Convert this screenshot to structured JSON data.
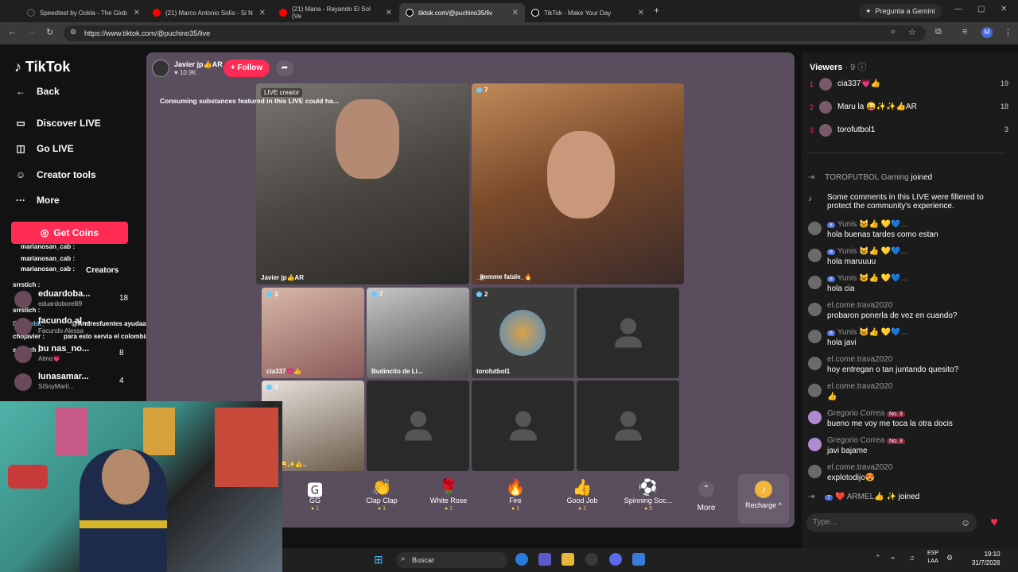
{
  "browser": {
    "tabs": [
      {
        "label": "Speedtest by Ookla - The Glob",
        "color": "#222",
        "active": false
      },
      {
        "label": "(21) Marco Antonio Solís - Si N",
        "color": "#ff0000",
        "active": false
      },
      {
        "label": "(21) Mana - Rayando El Sol (Ve",
        "color": "#ff0000",
        "active": false
      },
      {
        "label": "tiktok.com/@puchino35/liv",
        "color": "#111",
        "active": true
      },
      {
        "label": "TikTok - Make Your Day",
        "color": "#111",
        "active": false
      }
    ],
    "gemini_label": "Pregunta a Gemini",
    "url": "https://www.tiktok.com/@puchino35/live",
    "profile_initial": "M"
  },
  "sidebar": {
    "logo": "TikTok",
    "back": "Back",
    "items": [
      {
        "label": "Discover LIVE",
        "icon": "live-icon"
      },
      {
        "label": "Go LIVE",
        "icon": "camera-icon"
      },
      {
        "label": "Creator tools",
        "icon": "person-icon"
      },
      {
        "label": "More",
        "icon": "more-icon"
      }
    ],
    "get_coins": "Get Coins"
  },
  "left_overlay_chat": [
    "marianosan_cab :",
    "marianosan_cab :",
    "marianosan_cab :",
    "srrstich :",
    "srrstich :",
    "Deluxebk_",
    "@Andresfuentes ayudaaaaa",
    "chojavier :",
    "para esto servia el colombiano y el bolita agruck",
    "srrstich :",
    "Creators"
  ],
  "left_ranking": [
    {
      "name": "eduardoba...",
      "sub": "eduardoborelli9",
      "count": "18"
    },
    {
      "name": "facundo al...",
      "sub": "Facundo Alessa",
      "count": ""
    },
    {
      "name": "bu nas_no...",
      "sub": "Alma💗",
      "count": "8"
    },
    {
      "name": "lunasamar...",
      "sub": "SiSoyMaril...",
      "count": "4"
    }
  ],
  "live": {
    "host_name": "Javier jp👍AR",
    "host_likes": "10.9K",
    "follow_label": "+ Follow",
    "warning": "Consuming substances featured in this LIVE could ha...",
    "creator_badge": "LIVE creator",
    "main_left_label": "Javier jp👍AR",
    "main_right_label": "_𝕱emme fatale_🔥",
    "main_right_count": "7",
    "guests": [
      {
        "label": "cia337💗👍",
        "count": "3"
      },
      {
        "label": "Budincito de Li...",
        "count": "7"
      },
      {
        "label": "torofutbol1",
        "count": "2"
      },
      {
        "label": "",
        "count": ""
      },
      {
        "label": "u la 😜✨👍..",
        "count": "3"
      },
      {
        "label": "",
        "count": ""
      },
      {
        "label": "",
        "count": ""
      },
      {
        "label": "",
        "count": ""
      }
    ]
  },
  "gifts": [
    {
      "name": "GG",
      "icon": "gg-icon",
      "price": "1"
    },
    {
      "name": "Clap Clap",
      "icon": "clap-icon",
      "price": "1"
    },
    {
      "name": "White Rose",
      "icon": "rose-icon",
      "price": "1"
    },
    {
      "name": "Fire",
      "icon": "fire-icon",
      "price": "1"
    },
    {
      "name": "Good Job",
      "icon": "thumbs-up-icon",
      "price": "1"
    },
    {
      "name": "Spinning Soc...",
      "icon": "soccer-ball-icon",
      "price": "5"
    }
  ],
  "gift_more": "More",
  "recharge": "Recharge ^",
  "viewers": {
    "title": "Viewers",
    "count": "· 9",
    "list": [
      {
        "rank": "1",
        "name": "cia337💗👍",
        "count": "19"
      },
      {
        "rank": "2",
        "name": "Maru la 😜✨✨👍AR",
        "count": "18"
      },
      {
        "rank": "3",
        "name": "torofutbol1",
        "count": "3"
      }
    ]
  },
  "comments": [
    {
      "type": "sys",
      "text": "TOROFUTBOL Gaming",
      "suffix": "joined"
    },
    {
      "type": "sys2",
      "text": "Some comments in this LIVE were filtered to",
      "text2": "protect the community's experience."
    },
    {
      "type": "c",
      "badge": "8",
      "name": "Yunis 😺👍 💛💙...",
      "text": "hola buenas tardes como estan"
    },
    {
      "type": "c",
      "badge": "8",
      "name": "Yunis 😺👍 💛💙...",
      "text": "hola maruuuu"
    },
    {
      "type": "c",
      "badge": "8",
      "name": "Yunis 😺👍 💛💙...",
      "text": "hola cia"
    },
    {
      "type": "c",
      "badge": "",
      "name": "el.come.trava2020",
      "text": "probaron ponerla de vez en cuando?"
    },
    {
      "type": "c",
      "badge": "8",
      "name": "Yunis 😺👍 💛💙...",
      "text": "hola javi"
    },
    {
      "type": "c",
      "badge": "",
      "name": "el.come.trava2020",
      "text": "hoy entregan o tan juntando quesito?"
    },
    {
      "type": "c",
      "badge": "",
      "name": "el.come.trava2020",
      "text": "👍"
    },
    {
      "type": "c",
      "badge": "No. 3",
      "name": "Gregorio Correa",
      "text": "bueno me voy me toca la otra docis"
    },
    {
      "type": "c",
      "badge": "No. 3",
      "name": "Gregorio Correa",
      "text": "javi bajame"
    },
    {
      "type": "c",
      "badge": "",
      "name": "el.come.trava2020",
      "text": "explotodijo😍"
    },
    {
      "type": "sys3",
      "badge": "7",
      "text": "❤️ ARMEL👍 ✨",
      "suffix": "joined"
    }
  ],
  "type_placeholder": "Type...",
  "taskbar": {
    "search": "Buscar",
    "lang1": "ESP",
    "lang2": "LAA",
    "time": "19:10",
    "date": "31/7/2026"
  }
}
